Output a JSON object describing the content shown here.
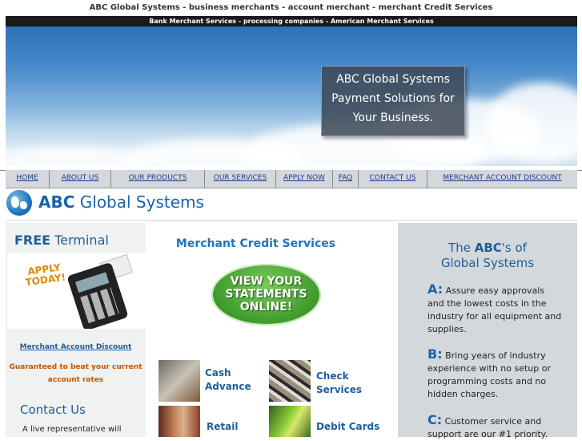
{
  "header": {
    "tagline": "ABC Global Systems - business merchants - account merchant - merchant Credit Services",
    "subtagline": "Bank Merchant Services - processing companies - American Merchant Services"
  },
  "hero": {
    "lines": [
      "ABC Global Systems",
      "Payment Solutions for",
      "Your Business."
    ]
  },
  "nav": {
    "items": [
      {
        "label": "HOME"
      },
      {
        "label": "ABOUT US"
      },
      {
        "label": "OUR PRODUCTS"
      },
      {
        "label": "OUR SERVICES"
      },
      {
        "label": "APPLY NOW"
      },
      {
        "label": "FAQ"
      },
      {
        "label": "CONTACT US"
      },
      {
        "label": "MERCHANT ACCOUNT DISCOUNT"
      }
    ]
  },
  "logo": {
    "brand": "ABC",
    "rest": " Global Systems"
  },
  "left": {
    "free_bold": "FREE",
    "free_rest": " Terminal",
    "apply_line1": "APPLY",
    "apply_line2": "TODAY!",
    "discount_link": "Merchant Account Discount",
    "guarantee_line1": "Guaranteed to beat your current",
    "guarantee_line2": "account rates",
    "contact_title": "Contact Us",
    "contact_text": "A live representative will"
  },
  "middle": {
    "title": "Merchant Credit Services",
    "statements_button": [
      "VIEW YOUR",
      "STATEMENTS",
      "ONLINE!"
    ],
    "services": [
      {
        "line1": "Cash",
        "line2": "Advance"
      },
      {
        "line1": "Check",
        "line2": "Services"
      },
      {
        "line1": "Retail",
        "line2": ""
      },
      {
        "line1": "Debit Cards",
        "line2": ""
      }
    ]
  },
  "right": {
    "title_pre": "The ",
    "title_abc": "ABC",
    "title_post": "'s of",
    "title_line2": "Global Systems",
    "points": [
      {
        "letter": "A",
        "colon": ":",
        "text": " Assure easy approvals and the lowest costs in the industry for all equipment and supplies."
      },
      {
        "letter": "B",
        "colon": ":",
        "text": " Bring years of industry experience with no setup or programming costs and no hidden charges."
      },
      {
        "letter": "C",
        "colon": ":",
        "text": " Customer service and support are our #1 priority."
      }
    ]
  },
  "colors": {
    "link_blue": "#1d3e87",
    "heading_blue": "#1f75bf",
    "orange": "#cc5500",
    "button_green": "#3c9a2a"
  }
}
